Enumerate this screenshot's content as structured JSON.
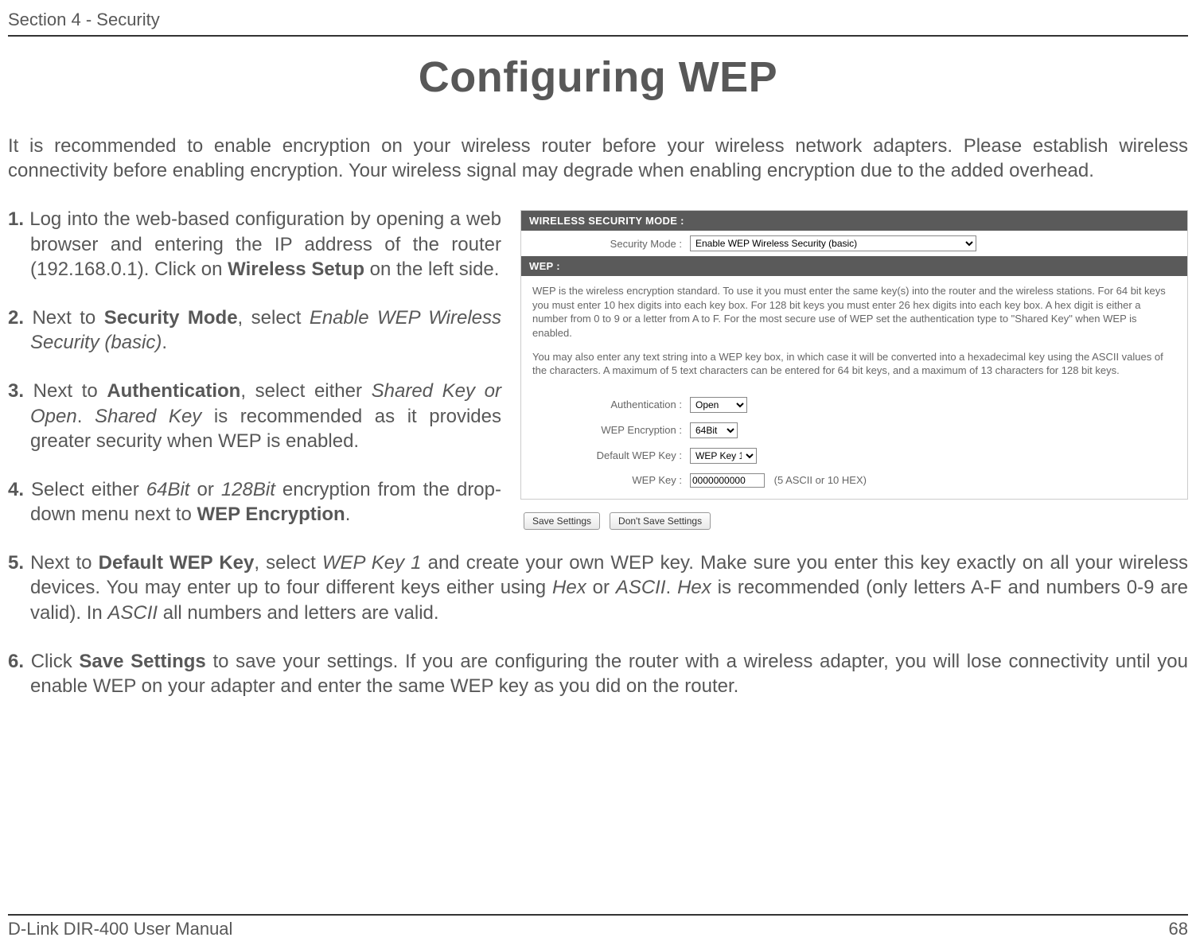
{
  "header": {
    "section": "Section 4 - Security"
  },
  "title": "Configuring WEP",
  "intro": "It is recommended to enable encryption on your wireless router before your wireless network adapters. Please establish wireless connectivity before enabling encryption. Your wireless signal may degrade when enabling encryption due to the added overhead.",
  "steps": {
    "s1_num": "1.",
    "s1_a": " Log into the web-based configuration by opening a web browser and entering the IP address of the router (192.168.0.1).  Click on ",
    "s1_b": "Wireless Setup",
    "s1_c": " on the left side.",
    "s2_num": "2.",
    "s2_a": " Next to ",
    "s2_b": "Security Mode",
    "s2_c": ", select ",
    "s2_d": "Enable WEP Wireless Security (basic)",
    "s2_e": ".",
    "s3_num": "3.",
    "s3_a": " Next to ",
    "s3_b": "Authentication",
    "s3_c": ", select either ",
    "s3_d": "Shared Key or Open",
    "s3_e": ". ",
    "s3_f": "Shared Key",
    "s3_g": " is recommended as it provides greater security when WEP is enabled.",
    "s4_num": "4.",
    "s4_a": " Select either ",
    "s4_b": "64Bit",
    "s4_c": " or ",
    "s4_d": "128Bit",
    "s4_e": " encryption from the drop-down menu next to ",
    "s4_f": "WEP Encryption",
    "s4_g": ".",
    "s5_num": "5.",
    "s5_a": " Next to ",
    "s5_b": "Default WEP Key",
    "s5_c": ", select ",
    "s5_d": "WEP Key 1",
    "s5_e": " and create your own WEP key. Make sure you enter this key exactly on all your wireless devices. You may enter up to four different keys either using ",
    "s5_f": "Hex",
    "s5_g": " or ",
    "s5_h": "ASCII",
    "s5_i": ". ",
    "s5_j": "Hex",
    "s5_k": " is recommended (only letters A-F and numbers 0-9 are valid). In ",
    "s5_l": "ASCII",
    "s5_m": " all numbers and letters are valid.",
    "s6_num": "6.",
    "s6_a": " Click ",
    "s6_b": "Save Settings",
    "s6_c": " to save your settings. If you are configuring the router with a wireless adapter, you will lose connectivity until you enable WEP on your adapter and enter the same WEP key as you did on the router."
  },
  "panel": {
    "sec_header": "WIRELESS SECURITY MODE :",
    "sec_label": "Security Mode :",
    "sec_value": "Enable WEP Wireless Security (basic)",
    "wep_header": "WEP :",
    "desc_p1": "WEP is the wireless encryption standard. To use it you must enter the same key(s) into the router and the wireless stations. For 64 bit keys you must enter 10 hex digits into each key box. For 128 bit keys you must enter 26 hex digits into each key box. A hex digit is either a number from 0 to 9 or a letter from A to F. For the most secure use of WEP set the authentication type to \"Shared Key\" when WEP is enabled.",
    "desc_p2": "You may also enter any text string into a WEP key box, in which case it will be converted into a hexadecimal key using the ASCII values of the characters. A maximum of 5 text characters can be entered for 64 bit keys, and a maximum of 13 characters for 128 bit keys.",
    "auth_label": "Authentication :",
    "auth_value": "Open",
    "enc_label": "WEP Encryption :",
    "enc_value": "64Bit",
    "defkey_label": "Default WEP Key :",
    "defkey_value": "WEP Key 1",
    "wepkey_label": "WEP Key :",
    "wepkey_value": "0000000000",
    "wepkey_hint": "(5 ASCII or 10 HEX)",
    "btn_save": "Save Settings",
    "btn_cancel": "Don't Save Settings"
  },
  "footer": {
    "left": "D-Link DIR-400 User Manual",
    "right": "68"
  }
}
